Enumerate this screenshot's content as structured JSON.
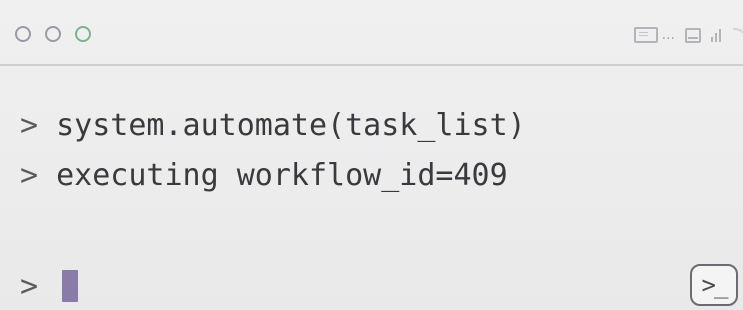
{
  "window": {
    "controls": [
      "close",
      "minimize",
      "zoom"
    ],
    "control_colors": {
      "close": "#9a9aa5",
      "minimize": "#9a9aa5",
      "zoom": "#7fb18e"
    },
    "status_icons": [
      "document-icon",
      "ellipsis",
      "window-icon",
      "signal-icon",
      "wifi-icon"
    ],
    "status_ellipsis": "..."
  },
  "terminal": {
    "prompt_symbol": ">",
    "lines": [
      {
        "prompt": ">",
        "text": "system.automate(task_list)"
      },
      {
        "prompt": ">",
        "text": "executing workflow_id=409"
      }
    ],
    "input": {
      "prompt": ">",
      "value": ""
    },
    "cursor_color": "#8b7ba8",
    "terminal_button_label": ">_"
  }
}
